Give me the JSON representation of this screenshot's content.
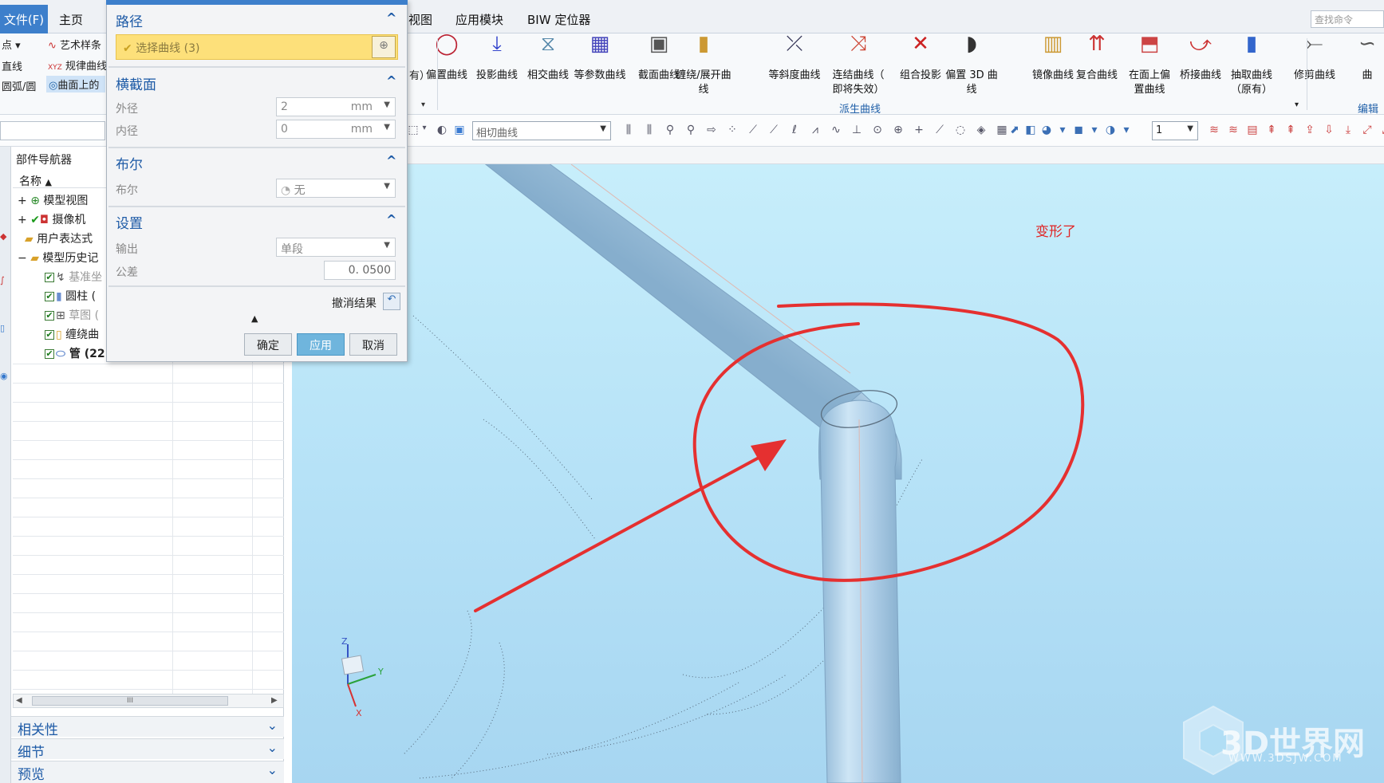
{
  "menu": {
    "file": "文件(F)",
    "home": "主页",
    "view": "视图",
    "app": "应用模块",
    "biw": "BIW 定位器",
    "search_placeholder": "查找命令"
  },
  "ribbon_left": {
    "point": "点",
    "line": "直线",
    "arc": "圆弧/圆",
    "art_spline": "艺术样条",
    "law_curve": "规律曲线",
    "curve_on_surface": "曲面上的",
    "cut_text": "有）"
  },
  "ribbon_buttons": [
    {
      "label1": "偏置曲线",
      "label2": ""
    },
    {
      "label1": "投影曲线",
      "label2": ""
    },
    {
      "label1": "相交曲线",
      "label2": ""
    },
    {
      "label1": "等参数曲线",
      "label2": ""
    },
    {
      "label1": "截面曲线",
      "label2": ""
    },
    {
      "label1": "缠绕/展开曲线",
      "label2": ""
    },
    {
      "label1": "等斜度曲线",
      "label2": ""
    },
    {
      "label1": "连结曲线（",
      "label2": "即将失效）"
    },
    {
      "label1": "组合投影",
      "label2": ""
    },
    {
      "label1": "偏置 3D 曲线",
      "label2": ""
    },
    {
      "label1": "镜像曲线",
      "label2": ""
    },
    {
      "label1": "复合曲线",
      "label2": ""
    },
    {
      "label1": "在面上偏",
      "label2": "置曲线"
    },
    {
      "label1": "桥接曲线",
      "label2": ""
    },
    {
      "label1": "抽取曲线",
      "label2": "（原有）"
    },
    {
      "label1": "修剪曲线",
      "label2": ""
    },
    {
      "label1": "曲",
      "label2": ""
    }
  ],
  "ribbon_group_label": "派生曲线",
  "ribbon_edit_label": "编辑",
  "toolbar2": {
    "curve_rule": "相切曲线",
    "number": "1"
  },
  "navigator": {
    "title": "部件导航器",
    "col_name": "名称",
    "items": [
      {
        "label": "模型视图"
      },
      {
        "label": "摄像机"
      },
      {
        "label": "用户表达式"
      },
      {
        "label": "模型历史记"
      },
      {
        "label": "基准坐"
      },
      {
        "label": "圆柱 ("
      },
      {
        "label": "草图 ("
      },
      {
        "label": "缠绕曲"
      },
      {
        "label": "管 (22"
      }
    ],
    "scroll_glyph": "III",
    "accordion": [
      "相关性",
      "细节",
      "预览"
    ]
  },
  "dialog": {
    "path_title": "路径",
    "select_curve": "选择曲线 (3)",
    "section_title": "横截面",
    "outer_label": "外径",
    "outer_value": "2",
    "outer_unit": "mm",
    "inner_label": "内径",
    "inner_value": "0",
    "inner_unit": "mm",
    "boolean_title": "布尔",
    "boolean_label": "布尔",
    "boolean_value": "无",
    "settings_title": "设置",
    "output_label": "输出",
    "output_value": "单段",
    "tolerance_label": "公差",
    "tolerance_value": "0. 0500",
    "undo_label": "撤消结果",
    "ok": "确定",
    "apply": "应用",
    "cancel": "取消"
  },
  "viewport": {
    "annotation": "变形了",
    "watermark": "3D世界网",
    "watermark_url": "WWW.3DSJW.COM",
    "triad_z": "Z",
    "triad_y": "Y",
    "triad_x": "X"
  },
  "colors": {
    "accent": "#3d7fcb",
    "annotation_red": "#e53030",
    "pipe": "#a9cde6",
    "viewport_bg": "#b9e4f8"
  }
}
